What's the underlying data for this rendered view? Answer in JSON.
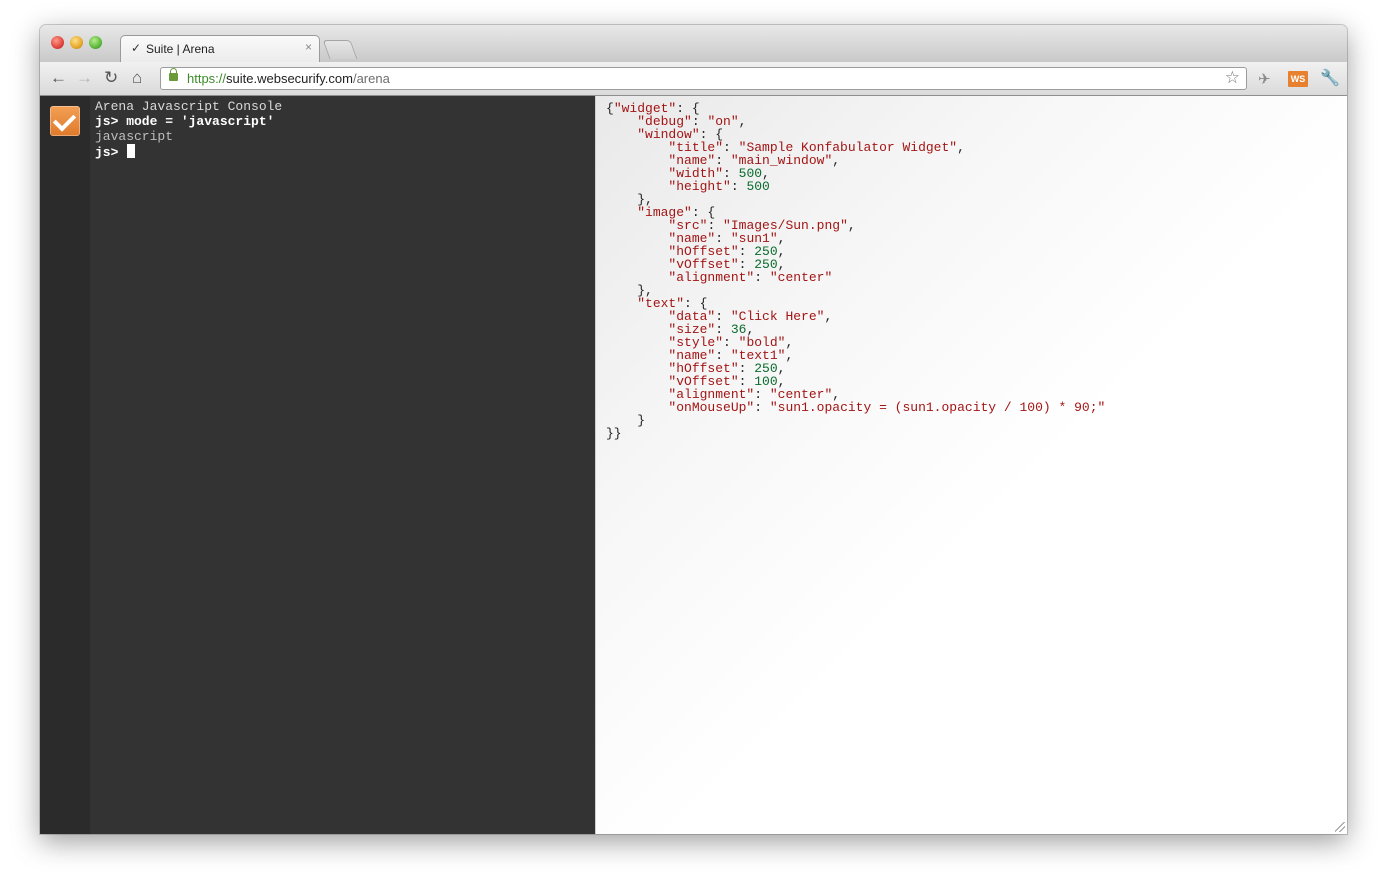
{
  "browser": {
    "tab_title": "Suite | Arena",
    "tab_close": "×",
    "url_scheme": "https://",
    "url_host": "suite.websecurify.com",
    "url_path": "/arena",
    "icons": {
      "back": "←",
      "forward": "→",
      "reload": "↻",
      "home": "⌂",
      "star": "☆",
      "extension": "✈",
      "websecurify": "WS",
      "wrench": "🔧",
      "tab_check": "✓"
    }
  },
  "console": {
    "title": "Arena Javascript Console",
    "lines": [
      {
        "type": "cmd",
        "text": "js> mode = 'javascript'"
      },
      {
        "type": "out",
        "text": "javascript"
      }
    ],
    "prompt": "js> "
  },
  "code": {
    "lines": [
      [
        [
          "p",
          "{"
        ],
        [
          "k",
          "\"widget\""
        ],
        [
          "p",
          ": {"
        ]
      ],
      [
        [
          "p",
          "    "
        ],
        [
          "k",
          "\"debug\""
        ],
        [
          "p",
          ": "
        ],
        [
          "s",
          "\"on\""
        ],
        [
          "p",
          ","
        ]
      ],
      [
        [
          "p",
          "    "
        ],
        [
          "k",
          "\"window\""
        ],
        [
          "p",
          ": {"
        ]
      ],
      [
        [
          "p",
          "        "
        ],
        [
          "k",
          "\"title\""
        ],
        [
          "p",
          ": "
        ],
        [
          "s",
          "\"Sample Konfabulator Widget\""
        ],
        [
          "p",
          ","
        ]
      ],
      [
        [
          "p",
          "        "
        ],
        [
          "k",
          "\"name\""
        ],
        [
          "p",
          ": "
        ],
        [
          "s",
          "\"main_window\""
        ],
        [
          "p",
          ","
        ]
      ],
      [
        [
          "p",
          "        "
        ],
        [
          "k",
          "\"width\""
        ],
        [
          "p",
          ": "
        ],
        [
          "n",
          "500"
        ],
        [
          "p",
          ","
        ]
      ],
      [
        [
          "p",
          "        "
        ],
        [
          "k",
          "\"height\""
        ],
        [
          "p",
          ": "
        ],
        [
          "n",
          "500"
        ]
      ],
      [
        [
          "p",
          "    },"
        ]
      ],
      [
        [
          "p",
          "    "
        ],
        [
          "k",
          "\"image\""
        ],
        [
          "p",
          ": {"
        ]
      ],
      [
        [
          "p",
          "        "
        ],
        [
          "k",
          "\"src\""
        ],
        [
          "p",
          ": "
        ],
        [
          "s",
          "\"Images/Sun.png\""
        ],
        [
          "p",
          ","
        ]
      ],
      [
        [
          "p",
          "        "
        ],
        [
          "k",
          "\"name\""
        ],
        [
          "p",
          ": "
        ],
        [
          "s",
          "\"sun1\""
        ],
        [
          "p",
          ","
        ]
      ],
      [
        [
          "p",
          "        "
        ],
        [
          "k",
          "\"hOffset\""
        ],
        [
          "p",
          ": "
        ],
        [
          "n",
          "250"
        ],
        [
          "p",
          ","
        ]
      ],
      [
        [
          "p",
          "        "
        ],
        [
          "k",
          "\"vOffset\""
        ],
        [
          "p",
          ": "
        ],
        [
          "n",
          "250"
        ],
        [
          "p",
          ","
        ]
      ],
      [
        [
          "p",
          "        "
        ],
        [
          "k",
          "\"alignment\""
        ],
        [
          "p",
          ": "
        ],
        [
          "s",
          "\"center\""
        ]
      ],
      [
        [
          "p",
          "    },"
        ]
      ],
      [
        [
          "p",
          "    "
        ],
        [
          "k",
          "\"text\""
        ],
        [
          "p",
          ": {"
        ]
      ],
      [
        [
          "p",
          "        "
        ],
        [
          "k",
          "\"data\""
        ],
        [
          "p",
          ": "
        ],
        [
          "s",
          "\"Click Here\""
        ],
        [
          "p",
          ","
        ]
      ],
      [
        [
          "p",
          "        "
        ],
        [
          "k",
          "\"size\""
        ],
        [
          "p",
          ": "
        ],
        [
          "n",
          "36"
        ],
        [
          "p",
          ","
        ]
      ],
      [
        [
          "p",
          "        "
        ],
        [
          "k",
          "\"style\""
        ],
        [
          "p",
          ": "
        ],
        [
          "s",
          "\"bold\""
        ],
        [
          "p",
          ","
        ]
      ],
      [
        [
          "p",
          "        "
        ],
        [
          "k",
          "\"name\""
        ],
        [
          "p",
          ": "
        ],
        [
          "s",
          "\"text1\""
        ],
        [
          "p",
          ","
        ]
      ],
      [
        [
          "p",
          "        "
        ],
        [
          "k",
          "\"hOffset\""
        ],
        [
          "p",
          ": "
        ],
        [
          "n",
          "250"
        ],
        [
          "p",
          ","
        ]
      ],
      [
        [
          "p",
          "        "
        ],
        [
          "k",
          "\"vOffset\""
        ],
        [
          "p",
          ": "
        ],
        [
          "n",
          "100"
        ],
        [
          "p",
          ","
        ]
      ],
      [
        [
          "p",
          "        "
        ],
        [
          "k",
          "\"alignment\""
        ],
        [
          "p",
          ": "
        ],
        [
          "s",
          "\"center\""
        ],
        [
          "p",
          ","
        ]
      ],
      [
        [
          "p",
          "        "
        ],
        [
          "k",
          "\"onMouseUp\""
        ],
        [
          "p",
          ": "
        ],
        [
          "s",
          "\"sun1.opacity = (sun1.opacity / 100) * 90;\""
        ]
      ],
      [
        [
          "p",
          "    }"
        ]
      ],
      [
        [
          "p",
          "}}"
        ]
      ]
    ]
  }
}
